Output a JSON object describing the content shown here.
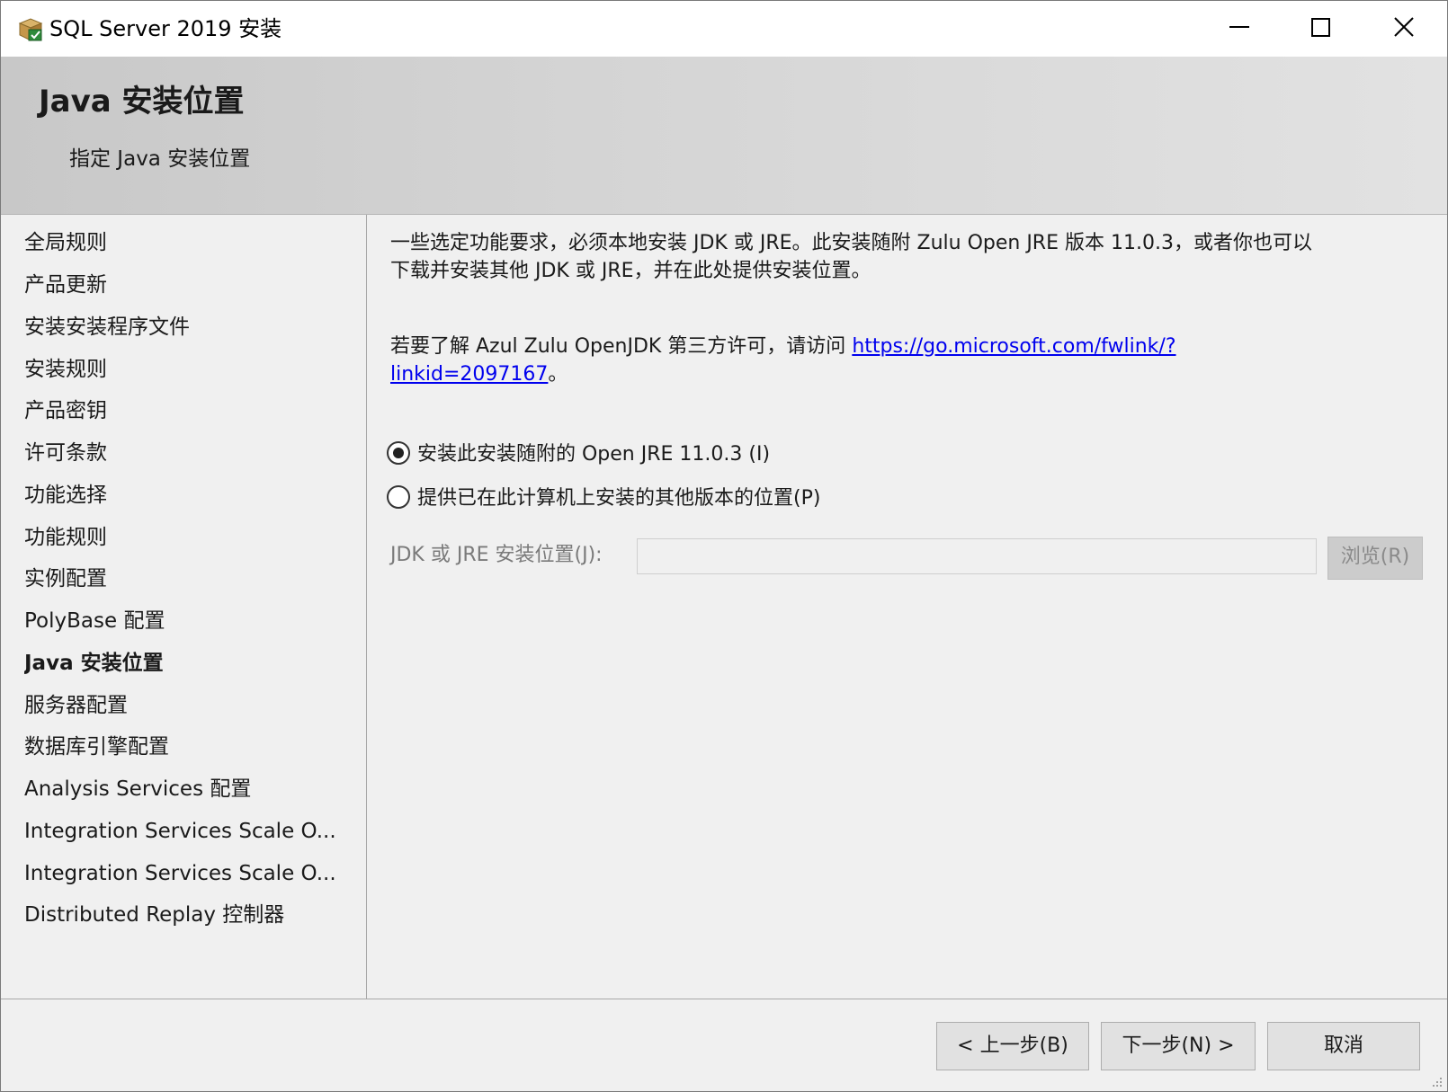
{
  "window": {
    "title": "SQL Server 2019 安装",
    "icon": "sql-setup-package-icon"
  },
  "banner": {
    "title": "Java 安装位置",
    "subtitle": "指定 Java 安装位置"
  },
  "nav": {
    "items": [
      {
        "label": "全局规则"
      },
      {
        "label": "产品更新"
      },
      {
        "label": "安装安装程序文件"
      },
      {
        "label": "安装规则"
      },
      {
        "label": "产品密钥"
      },
      {
        "label": "许可条款"
      },
      {
        "label": "功能选择"
      },
      {
        "label": "功能规则"
      },
      {
        "label": "实例配置"
      },
      {
        "label": "PolyBase 配置"
      },
      {
        "label": "Java 安装位置",
        "active": true
      },
      {
        "label": "服务器配置"
      },
      {
        "label": "数据库引擎配置"
      },
      {
        "label": "Analysis Services 配置"
      },
      {
        "label": "Integration Services Scale O..."
      },
      {
        "label": "Integration Services Scale O..."
      },
      {
        "label": "Distributed Replay 控制器"
      }
    ]
  },
  "content": {
    "intro_line1": "一些选定功能要求，必须本地安装 JDK 或 JRE。此安装随附 Zulu Open JRE 版本 11.0.3，或者你也可以",
    "intro_line2": "下载并安装其他 JDK 或 JRE，并在此处提供安装位置。",
    "license_prefix": "若要了解 Azul Zulu OpenJDK 第三方许可，请访问 ",
    "license_link_line1": "https://go.microsoft.com/fwlink/?",
    "license_link_line2": "linkid=2097167",
    "license_suffix": "。",
    "radio_bundled": "安装此安装随附的 Open JRE 11.0.3 (I)",
    "radio_other": "提供已在此计算机上安装的其他版本的位置(P)",
    "location_label": "JDK 或 JRE 安装位置(J):",
    "location_value": "",
    "browse_label": "浏览(R)",
    "selected_option": "bundled"
  },
  "footer": {
    "prev_label": "< 上一步(B)",
    "next_label": "下一步(N) >",
    "cancel_label": "取消"
  }
}
